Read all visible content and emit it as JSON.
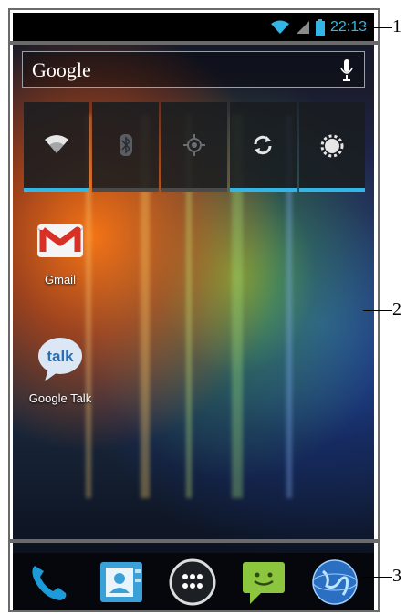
{
  "status_bar": {
    "time": "22:13",
    "icons": [
      "wifi-icon",
      "signal-icon",
      "battery-icon"
    ]
  },
  "search": {
    "label": "Google",
    "icon": "mic-icon"
  },
  "quick_toggles": [
    {
      "name": "wifi",
      "icon": "wifi-icon",
      "state": "on"
    },
    {
      "name": "bluetooth",
      "icon": "bluetooth-icon",
      "state": "off"
    },
    {
      "name": "gps",
      "icon": "gps-icon",
      "state": "off"
    },
    {
      "name": "sync",
      "icon": "sync-icon",
      "state": "on"
    },
    {
      "name": "brightness",
      "icon": "brightness-icon",
      "state": "on"
    }
  ],
  "apps": [
    {
      "label": "Gmail",
      "icon": "gmail-icon"
    },
    {
      "label": "Google Talk",
      "icon": "talk-icon",
      "badge": "talk"
    }
  ],
  "dock": [
    {
      "name": "phone",
      "icon": "phone-icon"
    },
    {
      "name": "contacts",
      "icon": "contacts-icon"
    },
    {
      "name": "all-apps",
      "icon": "app-drawer-icon"
    },
    {
      "name": "messaging",
      "icon": "messaging-icon"
    },
    {
      "name": "browser",
      "icon": "browser-globe-icon"
    }
  ],
  "callouts": {
    "one": "1",
    "two": "2",
    "three": "3"
  },
  "colors": {
    "accent": "#33b5e5",
    "dock_bg": "#05070d",
    "status_bg": "#000000"
  }
}
